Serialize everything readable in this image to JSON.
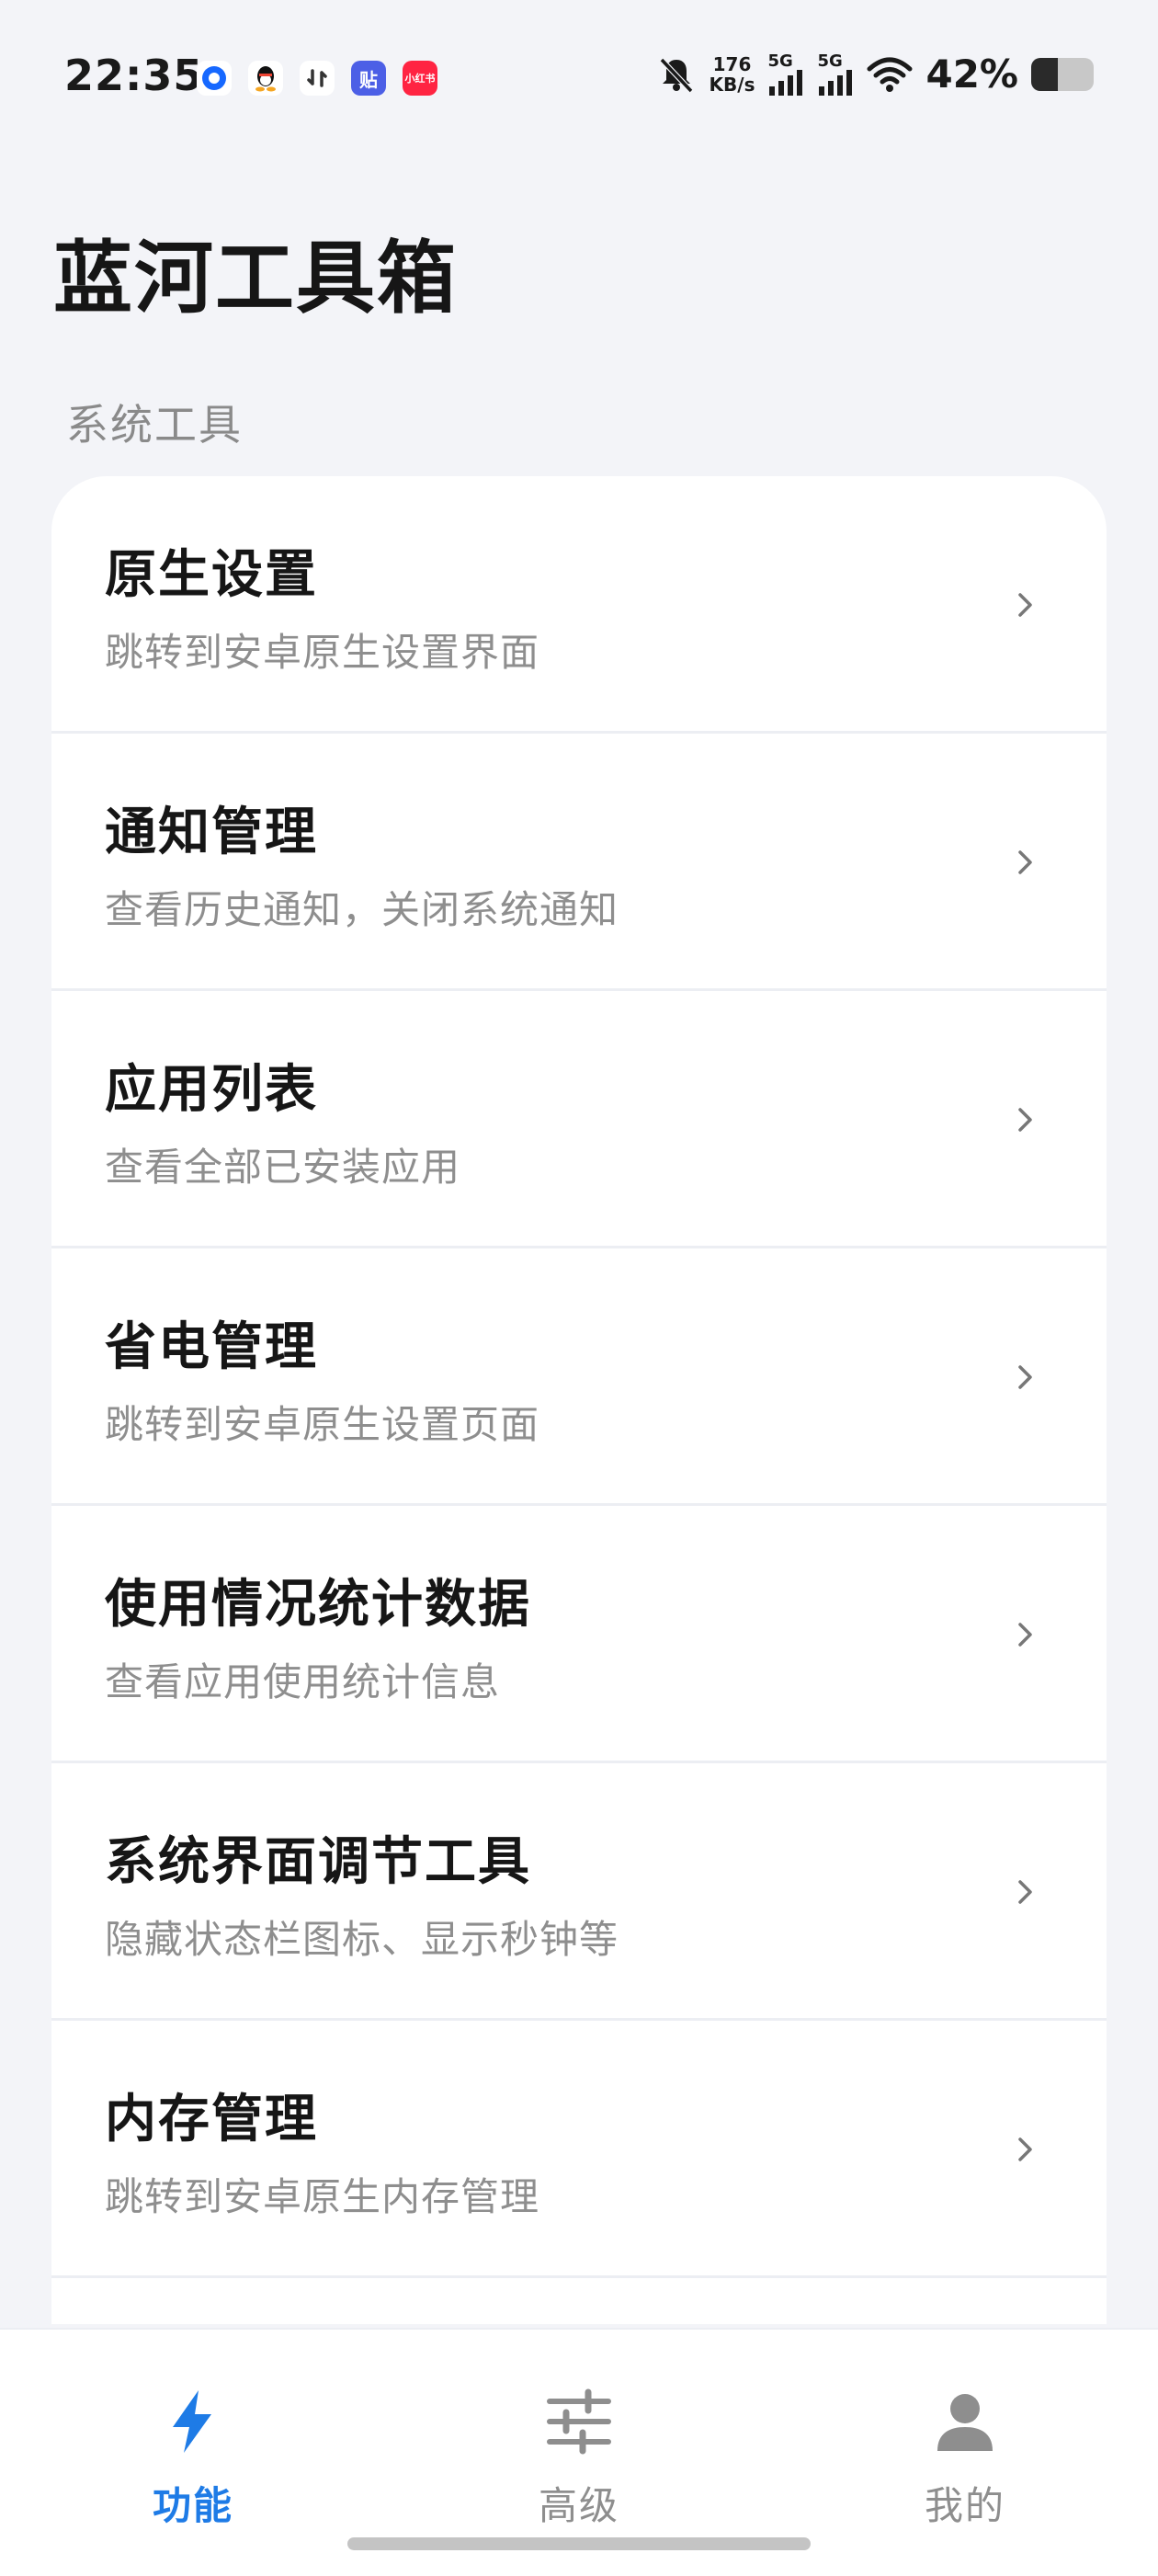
{
  "status_bar": {
    "time": "22:35",
    "net_speed_value": "176",
    "net_speed_unit": "KB/s",
    "sim1_label": "5G",
    "sim2_label": "5G",
    "battery_percent_text": "42%",
    "battery_level": 0.42,
    "notification_icons": [
      {
        "name": "blue-circle-app-icon",
        "color": "#1668ff",
        "glyph": "●"
      },
      {
        "name": "qq-icon",
        "color": "#111111",
        "glyph": "🐧"
      },
      {
        "name": "sync-app-icon",
        "color": "#444444",
        "glyph": "↻"
      },
      {
        "name": "tieba-icon",
        "color": "#4c5fe6",
        "glyph": "贴"
      },
      {
        "name": "xiaohongshu-icon",
        "color": "#ff2442",
        "glyph": "书"
      }
    ]
  },
  "app": {
    "title": "蓝河工具箱",
    "section_label": "系统工具"
  },
  "items": [
    {
      "title": "原生设置",
      "subtitle": "跳转到安卓原生设置界面"
    },
    {
      "title": "通知管理",
      "subtitle": "查看历史通知，关闭系统通知"
    },
    {
      "title": "应用列表",
      "subtitle": "查看全部已安装应用"
    },
    {
      "title": "省电管理",
      "subtitle": "跳转到安卓原生设置页面"
    },
    {
      "title": "使用情况统计数据",
      "subtitle": "查看应用使用统计信息"
    },
    {
      "title": "系统界面调节工具",
      "subtitle": "隐藏状态栏图标、显示秒钟等"
    },
    {
      "title": "内存管理",
      "subtitle": "跳转到安卓原生内存管理"
    }
  ],
  "nav": {
    "items": [
      {
        "label": "功能",
        "icon": "lightning-icon",
        "active": true
      },
      {
        "label": "高级",
        "icon": "sliders-icon",
        "active": false
      },
      {
        "label": "我的",
        "icon": "person-icon",
        "active": false
      }
    ],
    "accent_color": "#1e7be6"
  }
}
